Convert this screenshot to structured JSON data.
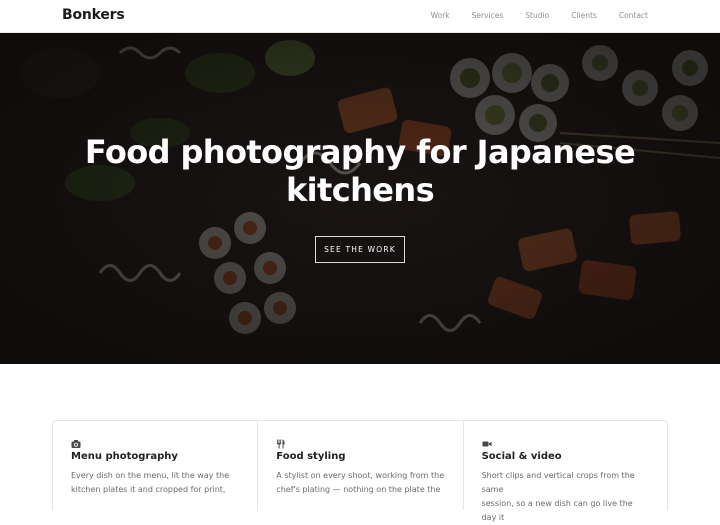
{
  "header": {
    "brand": "Bonkers",
    "nav": [
      {
        "label": "Work"
      },
      {
        "label": "Services"
      },
      {
        "label": "Studio"
      },
      {
        "label": "Clients"
      },
      {
        "label": "Contact"
      }
    ]
  },
  "hero": {
    "title_line1": "Food photography for Japanese",
    "title_line2": "kitchens",
    "cta_label": "SEE THE WORK"
  },
  "services": [
    {
      "icon": "camera-icon",
      "title": "Menu photography",
      "text_line1": "Every dish on the menu, lit the way the",
      "text_line2": "kitchen plates it and cropped for print,"
    },
    {
      "icon": "utensils-icon",
      "title": "Food styling",
      "text_line1": "A stylist on every shoot, working from the",
      "text_line2": "chef's plating — nothing on the plate the"
    },
    {
      "icon": "video-icon",
      "title": "Social & video",
      "text_line1": "Short clips and vertical crops from the same",
      "text_line2": "session, so a new dish can go live the day it"
    }
  ]
}
